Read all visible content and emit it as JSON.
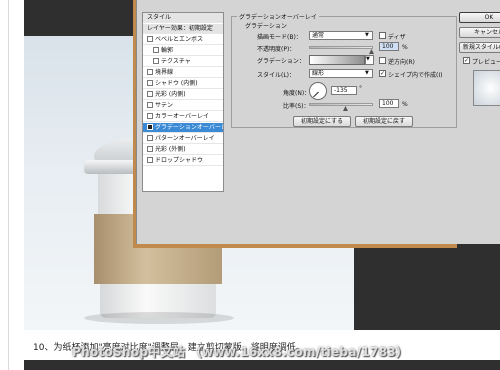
{
  "dialog": {
    "styles_list": [
      {
        "label": "スタイル",
        "kind": "head",
        "checked": null
      },
      {
        "label": "レイヤー効果：初期設定",
        "kind": "head",
        "checked": null
      },
      {
        "label": "ベベルとエンボス",
        "kind": "item",
        "checked": false
      },
      {
        "label": "輪郭",
        "kind": "indent",
        "checked": false
      },
      {
        "label": "テクスチャ",
        "kind": "indent",
        "checked": false
      },
      {
        "label": "境界線",
        "kind": "item",
        "checked": false
      },
      {
        "label": "シャドウ (内側)",
        "kind": "item",
        "checked": false
      },
      {
        "label": "光彩 (内側)",
        "kind": "item",
        "checked": false
      },
      {
        "label": "サテン",
        "kind": "item",
        "checked": false
      },
      {
        "label": "カラーオーバーレイ",
        "kind": "item",
        "checked": false
      },
      {
        "label": "グラデーションオーバーレイ",
        "kind": "selected",
        "checked": true
      },
      {
        "label": "パターンオーバーレイ",
        "kind": "item",
        "checked": false
      },
      {
        "label": "光彩 (外側)",
        "kind": "item",
        "checked": false
      },
      {
        "label": "ドロップシャドウ",
        "kind": "item",
        "checked": false
      }
    ],
    "group_title": "グラデーションオーバーレイ",
    "subgroup_title": "グラデーション",
    "blend_mode_label": "描画モード(B)：",
    "blend_mode_value": "通常",
    "dither_label": "ディザ",
    "dither_checked": false,
    "opacity_label": "不透明度(P)：",
    "opacity_value": "100",
    "opacity_unit": "%",
    "gradient_label": "グラデーション：",
    "reverse_label": "逆方向(R)",
    "reverse_checked": false,
    "style_label": "スタイル(L)：",
    "style_value": "線形",
    "align_label": "シェイプ内で作成(I)",
    "align_checked": true,
    "angle_label": "角度(N)：",
    "angle_value": "-135",
    "angle_unit": "°",
    "scale_label": "比率(S)：",
    "scale_value": "100",
    "scale_unit": "%",
    "make_default_label": "初期設定にする",
    "reset_default_label": "初期設定に戻す",
    "ok_label": "OK",
    "cancel_label": "キャンセル",
    "new_style_label": "新規スタイル(W)...",
    "preview_label": "プレビュー(V)",
    "preview_checked": true
  },
  "caption": "10、为纸杯添加\"亮度对比度\"调整层，建立剪切蒙版，将明度调低。",
  "watermark": "PhotoShop中文站 （www.16xx8.com/tieba/1783）"
}
